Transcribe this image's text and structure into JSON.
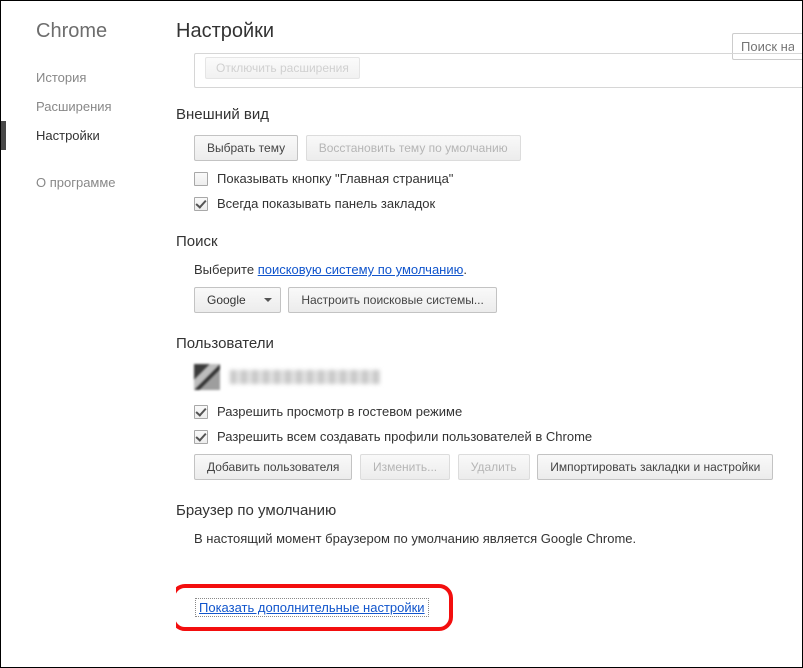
{
  "brand": "Chrome",
  "page_title": "Настройки",
  "search_placeholder": "Поиск нас",
  "nav": {
    "history": "История",
    "extensions": "Расширения",
    "settings": "Настройки",
    "about": "О программе"
  },
  "truncated_button": "Отключить расширения",
  "appearance": {
    "title": "Внешний вид",
    "choose_theme": "Выбрать тему",
    "reset_theme": "Восстановить тему по умолчанию",
    "show_home": "Показывать кнопку \"Главная страница\"",
    "show_home_checked": false,
    "show_bookmarks": "Всегда показывать панель закладок",
    "show_bookmarks_checked": true
  },
  "search": {
    "title": "Поиск",
    "help_prefix": "Выберите ",
    "help_link": "поисковую систему по умолчанию",
    "help_suffix": ".",
    "engine": "Google",
    "manage": "Настроить поисковые системы..."
  },
  "users": {
    "title": "Пользователи",
    "guest": "Разрешить просмотр в гостевом режиме",
    "guest_checked": true,
    "create": "Разрешить всем создавать профили пользователей в Chrome",
    "create_checked": true,
    "add": "Добавить пользователя",
    "edit": "Изменить...",
    "delete": "Удалить",
    "import": "Импортировать закладки и настройки"
  },
  "default_browser": {
    "title": "Браузер по умолчанию",
    "status": "В настоящий момент браузером по умолчанию является Google Chrome."
  },
  "advanced_link": "Показать дополнительные настройки"
}
